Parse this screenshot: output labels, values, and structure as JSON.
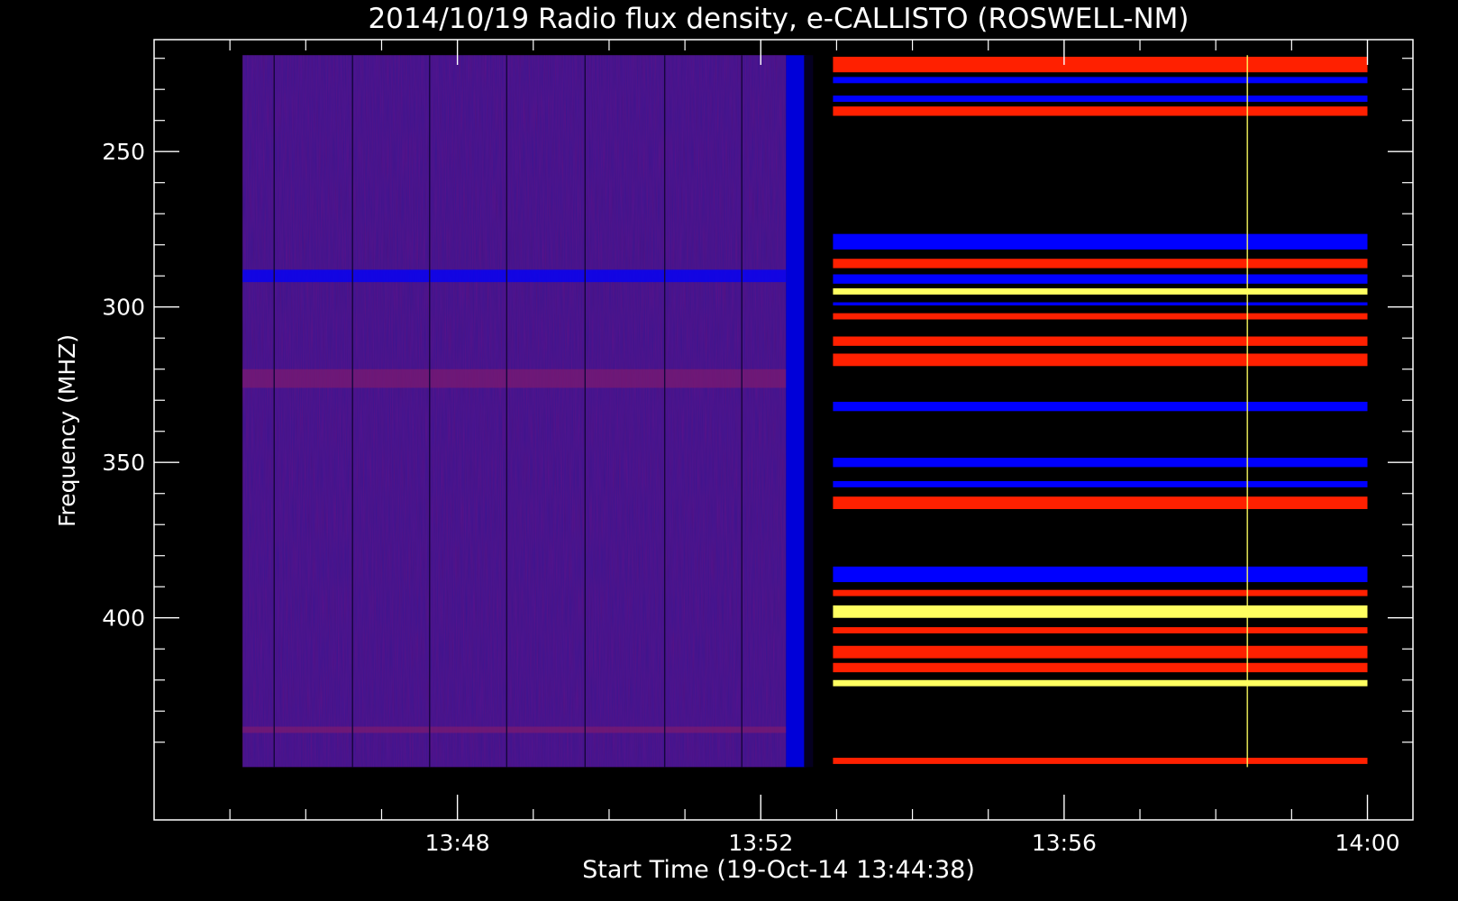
{
  "chart_data": {
    "type": "heatmap",
    "title": "2014/10/19  Radio flux density, e-CALLISTO (ROSWELL-NM)",
    "xlabel": "Start Time (19-Oct-14 13:44:38)",
    "ylabel": "Frequency (MHZ)",
    "x_axis": {
      "type": "time",
      "range": [
        "13:44:00",
        "14:00:36"
      ],
      "data_range": [
        "13:45:10",
        "14:00:00"
      ],
      "major_ticks": [
        "13:48",
        "13:52",
        "13:56",
        "14:00"
      ],
      "minor_ticks": [
        "13:45",
        "13:46",
        "13:47",
        "13:49",
        "13:50",
        "13:51",
        "13:53",
        "13:54",
        "13:55",
        "13:57",
        "13:58",
        "13:59"
      ]
    },
    "y_axis": {
      "inverted": true,
      "range": [
        214,
        465
      ],
      "data_range": [
        219,
        448
      ],
      "major_ticks": [
        250,
        300,
        350,
        400
      ],
      "minor_ticks": [
        220,
        230,
        240,
        260,
        270,
        280,
        290,
        310,
        320,
        330,
        340,
        360,
        370,
        380,
        390,
        410,
        420,
        430,
        440
      ]
    },
    "colors": {
      "background": "#000000",
      "low": "#3c1690",
      "mid": "#0000ff",
      "high": "#ff2000",
      "peak": "#ffff60"
    },
    "transition_time": "13:52:30",
    "pre_event": {
      "range": [
        "13:45:10",
        "13:52:20"
      ],
      "level": "low",
      "vertical_lines_at": [
        "13:45:35",
        "13:46:37",
        "13:47:38",
        "13:48:39",
        "13:49:41",
        "13:50:44",
        "13:51:45"
      ],
      "bands": [
        {
          "freq": 290,
          "width": 4,
          "level": "mid"
        },
        {
          "freq": 323,
          "width": 6,
          "level": "low-red"
        },
        {
          "freq": 436,
          "width": 2,
          "level": "low-red"
        }
      ]
    },
    "post_event": {
      "range": [
        "13:53:00",
        "14:00:00"
      ],
      "bands": [
        {
          "freq": 222,
          "width": 5,
          "level": "high"
        },
        {
          "freq": 227,
          "width": 2,
          "level": "mid"
        },
        {
          "freq": 233,
          "width": 2,
          "level": "mid"
        },
        {
          "freq": 237,
          "width": 3,
          "level": "high"
        },
        {
          "freq": 279,
          "width": 5,
          "level": "mid"
        },
        {
          "freq": 286,
          "width": 3,
          "level": "high"
        },
        {
          "freq": 291,
          "width": 3,
          "level": "mid"
        },
        {
          "freq": 295,
          "width": 2,
          "level": "peak"
        },
        {
          "freq": 299,
          "width": 1,
          "level": "mid"
        },
        {
          "freq": 303,
          "width": 2,
          "level": "high"
        },
        {
          "freq": 311,
          "width": 3,
          "level": "high"
        },
        {
          "freq": 317,
          "width": 4,
          "level": "high"
        },
        {
          "freq": 332,
          "width": 3,
          "level": "mid"
        },
        {
          "freq": 350,
          "width": 3,
          "level": "mid"
        },
        {
          "freq": 357,
          "width": 2,
          "level": "mid"
        },
        {
          "freq": 363,
          "width": 4,
          "level": "high"
        },
        {
          "freq": 386,
          "width": 5,
          "level": "mid"
        },
        {
          "freq": 392,
          "width": 2,
          "level": "high"
        },
        {
          "freq": 398,
          "width": 4,
          "level": "peak"
        },
        {
          "freq": 404,
          "width": 2,
          "level": "high"
        },
        {
          "freq": 411,
          "width": 4,
          "level": "high"
        },
        {
          "freq": 416,
          "width": 3,
          "level": "high"
        },
        {
          "freq": 421,
          "width": 2,
          "level": "peak"
        },
        {
          "freq": 446,
          "width": 2,
          "level": "high"
        }
      ],
      "vertical_spike_at": "13:58:25"
    }
  }
}
